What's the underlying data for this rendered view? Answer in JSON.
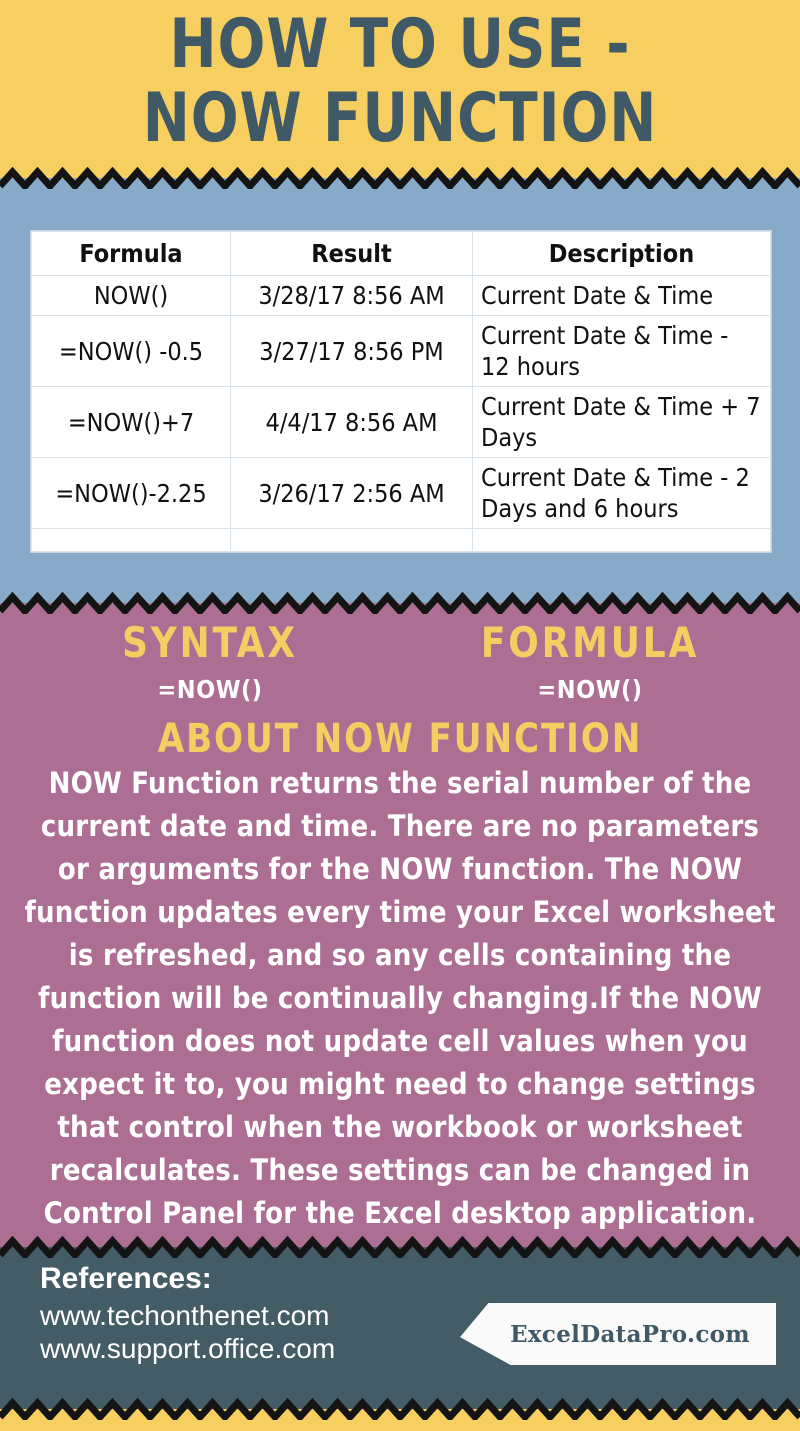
{
  "header": {
    "title_line1": "HOW TO USE -",
    "title_line2": "NOW FUNCTION"
  },
  "table": {
    "columns": [
      "Formula",
      "Result",
      "Description"
    ],
    "rows": [
      {
        "formula": "NOW()",
        "result": "3/28/17 8:56 AM",
        "description": "Current Date & Time"
      },
      {
        "formula": "=NOW() -0.5",
        "result": "3/27/17 8:56 PM",
        "description": "Current Date & Time - 12 hours"
      },
      {
        "formula": "=NOW()+7",
        "result": "4/4/17 8:56 AM",
        "description": "Current Date & Time + 7 Days"
      },
      {
        "formula": "=NOW()-2.25",
        "result": "3/26/17 2:56 AM",
        "description": "Current Date & Time - 2 Days and 6 hours"
      }
    ]
  },
  "about": {
    "syntax_label": "SYNTAX",
    "syntax_value": "=NOW()",
    "formula_label": "FORMULA",
    "formula_value": "=NOW()",
    "about_label": "ABOUT NOW FUNCTION",
    "about_text": "NOW Function returns the serial number of the current date and time. There are no parameters or arguments for the NOW function. The NOW function updates every time your Excel worksheet is refreshed, and so any cells containing the function will be continually changing.If the NOW function does not update cell values when you expect it to, you might need to change settings that control when the workbook or worksheet recalculates. These settings can be changed in Control Panel for the Excel desktop application."
  },
  "footer": {
    "references_label": "References:",
    "reference_1": "www.techonthenet.com",
    "reference_2": "www.support.office.com",
    "logo_text": "ExcelDataPro.com"
  },
  "colors": {
    "yellow": "#F7CF60",
    "blue": "#86AAC8",
    "mauve": "#AC6E92",
    "slate": "#435C66",
    "gold_text": "#F5CE63",
    "white": "#FFFFFF",
    "zigzag_black": "#141414"
  }
}
